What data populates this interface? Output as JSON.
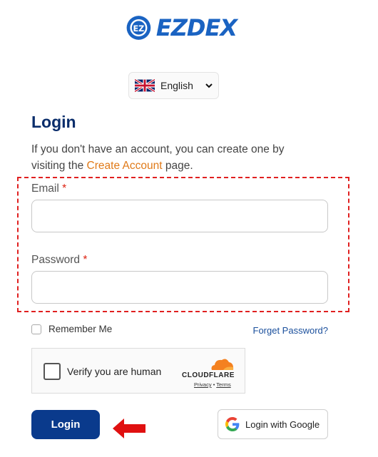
{
  "brand": {
    "name": "EZDEX",
    "accent": "#1a63c2",
    "brand_dark": "#0a2d6b"
  },
  "language": {
    "selected": "English",
    "flag": "uk-flag-icon"
  },
  "login": {
    "title": "Login",
    "desc_prefix": "If you don't have an account, you can create one by visiting the ",
    "create_link": "Create Account",
    "desc_suffix": " page.",
    "email_label": "Email",
    "password_label": "Password",
    "required_mark": "*",
    "email_value": "",
    "password_value": "",
    "remember_label": "Remember Me",
    "forgot_label": "Forget Password?",
    "submit_label": "Login",
    "google_label": "Login with Google"
  },
  "captcha": {
    "label": "Verify you are human",
    "provider": "CLOUDFLARE",
    "privacy": "Privacy",
    "separator": "•",
    "terms": "Terms"
  },
  "colors": {
    "highlight_border": "#e02020",
    "arrow": "#e01010",
    "button": "#0a3a8c",
    "link": "#e07a18"
  }
}
